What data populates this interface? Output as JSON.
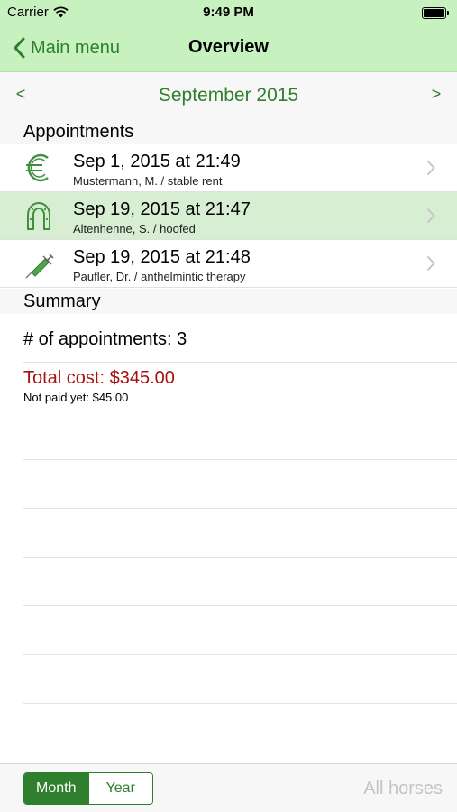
{
  "status": {
    "carrier": "Carrier",
    "time": "9:49 PM"
  },
  "nav": {
    "back_label": "Main menu",
    "title": "Overview"
  },
  "month": {
    "label": "September 2015",
    "prev": "<",
    "next": ">"
  },
  "appointments": {
    "header": "Appointments",
    "items": [
      {
        "title": "Sep 1, 2015 at 21:49",
        "subtitle": "Mustermann, M. / stable rent",
        "icon": "euro-icon"
      },
      {
        "title": "Sep 19, 2015 at 21:47",
        "subtitle": "Altenhenne, S. / hoofed",
        "icon": "horseshoe-icon",
        "selected": true
      },
      {
        "title": "Sep 19, 2015 at 21:48",
        "subtitle": "Paufler, Dr. / anthelmintic therapy",
        "icon": "syringe-icon"
      }
    ]
  },
  "summary": {
    "header": "Summary",
    "count_text": "# of appointments: 3",
    "total_text": "Total cost: $345.00",
    "unpaid_text": "Not paid yet: $45.00"
  },
  "toolbar": {
    "segments": [
      "Month",
      "Year"
    ],
    "selected": "Month",
    "filter_label": "All horses"
  },
  "colors": {
    "accent": "#2e7f2e",
    "navbar": "#c8f1c0",
    "selected_row": "#d8eed3",
    "cost": "#a61111"
  }
}
